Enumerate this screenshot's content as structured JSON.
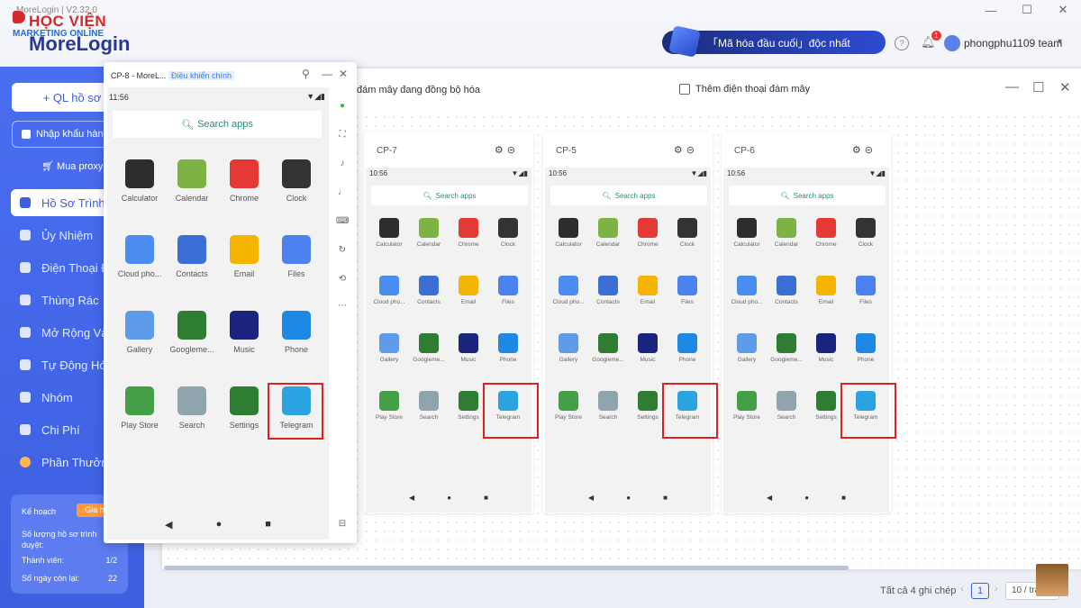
{
  "window": {
    "title": "MoreLogin | V2.32.0"
  },
  "brand": {
    "badge": "HỌC VIỆN",
    "badge_sub": "MARKETING ONLINE",
    "name": "MoreLogin"
  },
  "header": {
    "promo": "「Mã hóa đầu cuối」độc nhất",
    "help_icon": "?",
    "notif_count": "1",
    "user": "phongphu1109 team"
  },
  "sidebar": {
    "add_button": "+ QL hồ sơ",
    "import_button": "Nhập khẩu hàng",
    "proxy_link": "Mua proxy",
    "items": [
      {
        "label": "Hồ Sơ Trình"
      },
      {
        "label": "Ủy Nhiệm"
      },
      {
        "label": "Điện Thoại Đ"
      },
      {
        "label": "Thùng Rác"
      },
      {
        "label": "Mở Rộng Và"
      },
      {
        "label": "Tự Động Hó"
      },
      {
        "label": "Nhóm"
      },
      {
        "label": "Chi Phí"
      },
      {
        "label": "Phần Thưởn"
      }
    ],
    "plan": {
      "label": "Kế hoạch",
      "renew": "Gia h",
      "pending_label": "Số lượng hồ sơ trình duyệt:",
      "members_label": "Thành viên:",
      "members_value": "1/2",
      "days_label": "Số ngày còn lại:",
      "days_value": "22"
    }
  },
  "cloud_panel": {
    "sync_text": "đám mây đang đồng bộ hóa",
    "add_phone": "Thêm điện thoại đám mây"
  },
  "popup": {
    "title": "CP-8 - MoreL...",
    "control": "Điều khiển chính",
    "time": "11:56",
    "search": "Search apps",
    "apps": [
      "Calculator",
      "Calendar",
      "Chrome",
      "Clock",
      "Cloud pho...",
      "Contacts",
      "Email",
      "Files",
      "Gallery",
      "Googleme...",
      "Music",
      "Phone",
      "Play Store",
      "Search",
      "Settings",
      "Telegram"
    ]
  },
  "cards": [
    {
      "name": "CP-7",
      "time": "10:56",
      "search": "Search apps"
    },
    {
      "name": "CP-5",
      "time": "10:56",
      "search": "Search apps"
    },
    {
      "name": "CP-6",
      "time": "10:56",
      "search": "Search apps"
    }
  ],
  "card_apps": [
    "Calculator",
    "Calendar",
    "Chrome",
    "Clock",
    "Cloud pho...",
    "Contacts",
    "Email",
    "Files",
    "Gallery",
    "Googleme...",
    "Music",
    "Phone",
    "Play Store",
    "Search",
    "Settings",
    "Telegram"
  ],
  "app_colors": [
    "#2d2d2d",
    "#7cb342",
    "#e53935",
    "#333333",
    "#4b8cf0",
    "#3b6fd6",
    "#f4b400",
    "#4b82f0",
    "#5e9be8",
    "#2e7d32",
    "#1a237e",
    "#1e88e5",
    "#43a047",
    "#90a4ae",
    "#2e7d32",
    "#2aa3e0"
  ],
  "footer": {
    "total": "Tất cả 4 ghi chép",
    "page": "1",
    "page_size": "10 / trang"
  }
}
